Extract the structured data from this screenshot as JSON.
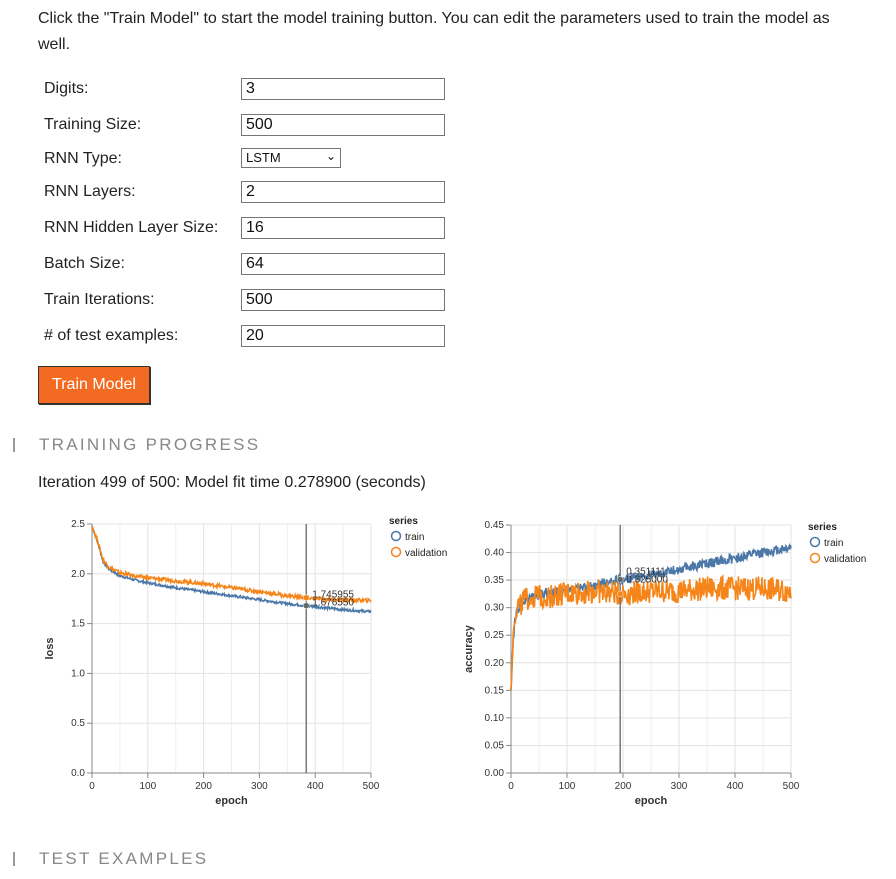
{
  "intro": "Click the \"Train Model\" to start the model training button. You can edit the parameters used to train the model as well.",
  "params": [
    {
      "label": "Digits:",
      "value": "3"
    },
    {
      "label": "Training Size:",
      "value": "500"
    },
    {
      "label": "RNN Type:",
      "value": "LSTM"
    },
    {
      "label": "RNN Layers:",
      "value": "2"
    },
    {
      "label": "RNN Hidden Layer Size:",
      "value": "16"
    },
    {
      "label": "Batch Size:",
      "value": "64"
    },
    {
      "label": "Train Iterations:",
      "value": "500"
    },
    {
      "label": "# of test examples:",
      "value": "20"
    }
  ],
  "train_button": "Train Model",
  "sections": {
    "progress": "TRAINING PROGRESS",
    "test": "TEST EXAMPLES"
  },
  "status": "Iteration 499 of 500: Model fit time 0.278900 (seconds)",
  "colors": {
    "accent": "#f36b22",
    "train": "#4c78a8",
    "validation": "#f58518"
  },
  "chart_data": [
    {
      "type": "line",
      "xlabel": "epoch",
      "ylabel": "loss",
      "xlim": [
        0,
        500
      ],
      "ylim": [
        0,
        2.5
      ],
      "xticks": [
        "0",
        "100",
        "200",
        "300",
        "400",
        "500"
      ],
      "yticks": [
        "0.0",
        "0.5",
        "1.0",
        "1.5",
        "2.0",
        "2.5"
      ],
      "grid": true,
      "legend": {
        "title": "series",
        "placement": "right"
      },
      "series": [
        {
          "name": "train",
          "x": [
            0,
            10,
            20,
            30,
            50,
            75,
            100,
            150,
            200,
            250,
            300,
            350,
            384,
            400,
            450,
            500
          ],
          "y": [
            2.48,
            2.32,
            2.12,
            2.05,
            1.98,
            1.94,
            1.91,
            1.86,
            1.82,
            1.78,
            1.74,
            1.7,
            1.68,
            1.67,
            1.64,
            1.62
          ]
        },
        {
          "name": "validation",
          "x": [
            0,
            10,
            20,
            30,
            50,
            75,
            100,
            150,
            200,
            250,
            300,
            350,
            384,
            400,
            450,
            500
          ],
          "y": [
            2.48,
            2.33,
            2.14,
            2.07,
            2.01,
            1.98,
            1.96,
            1.93,
            1.9,
            1.86,
            1.82,
            1.78,
            1.76,
            1.75,
            1.74,
            1.73
          ]
        }
      ],
      "cursor": {
        "x": 384,
        "labels": [
          "1.745955",
          "1.676550"
        ]
      }
    },
    {
      "type": "line",
      "xlabel": "epoch",
      "ylabel": "accuracy",
      "xlim": [
        0,
        500
      ],
      "ylim": [
        0,
        0.45
      ],
      "xticks": [
        "0",
        "100",
        "200",
        "300",
        "400",
        "500"
      ],
      "yticks": [
        "0.00",
        "0.05",
        "0.10",
        "0.15",
        "0.20",
        "0.25",
        "0.30",
        "0.35",
        "0.40",
        "0.45"
      ],
      "grid": true,
      "legend": {
        "title": "series",
        "placement": "right"
      },
      "series": [
        {
          "name": "train",
          "x": [
            0,
            3,
            6,
            10,
            20,
            40,
            60,
            100,
            150,
            195,
            250,
            300,
            350,
            400,
            450,
            500
          ],
          "y": [
            0.15,
            0.22,
            0.27,
            0.29,
            0.31,
            0.32,
            0.325,
            0.33,
            0.34,
            0.351,
            0.36,
            0.37,
            0.38,
            0.39,
            0.4,
            0.41
          ]
        },
        {
          "name": "validation",
          "x": [
            0,
            3,
            6,
            10,
            20,
            40,
            60,
            100,
            150,
            195,
            250,
            300,
            350,
            400,
            450,
            500
          ],
          "y": [
            0.15,
            0.23,
            0.28,
            0.3,
            0.31,
            0.32,
            0.32,
            0.325,
            0.33,
            0.325,
            0.33,
            0.33,
            0.335,
            0.335,
            0.335,
            0.33
          ]
        }
      ],
      "cursor": {
        "x": 195,
        "labels": [
          "0.351111",
          "0.325000"
        ]
      }
    }
  ]
}
